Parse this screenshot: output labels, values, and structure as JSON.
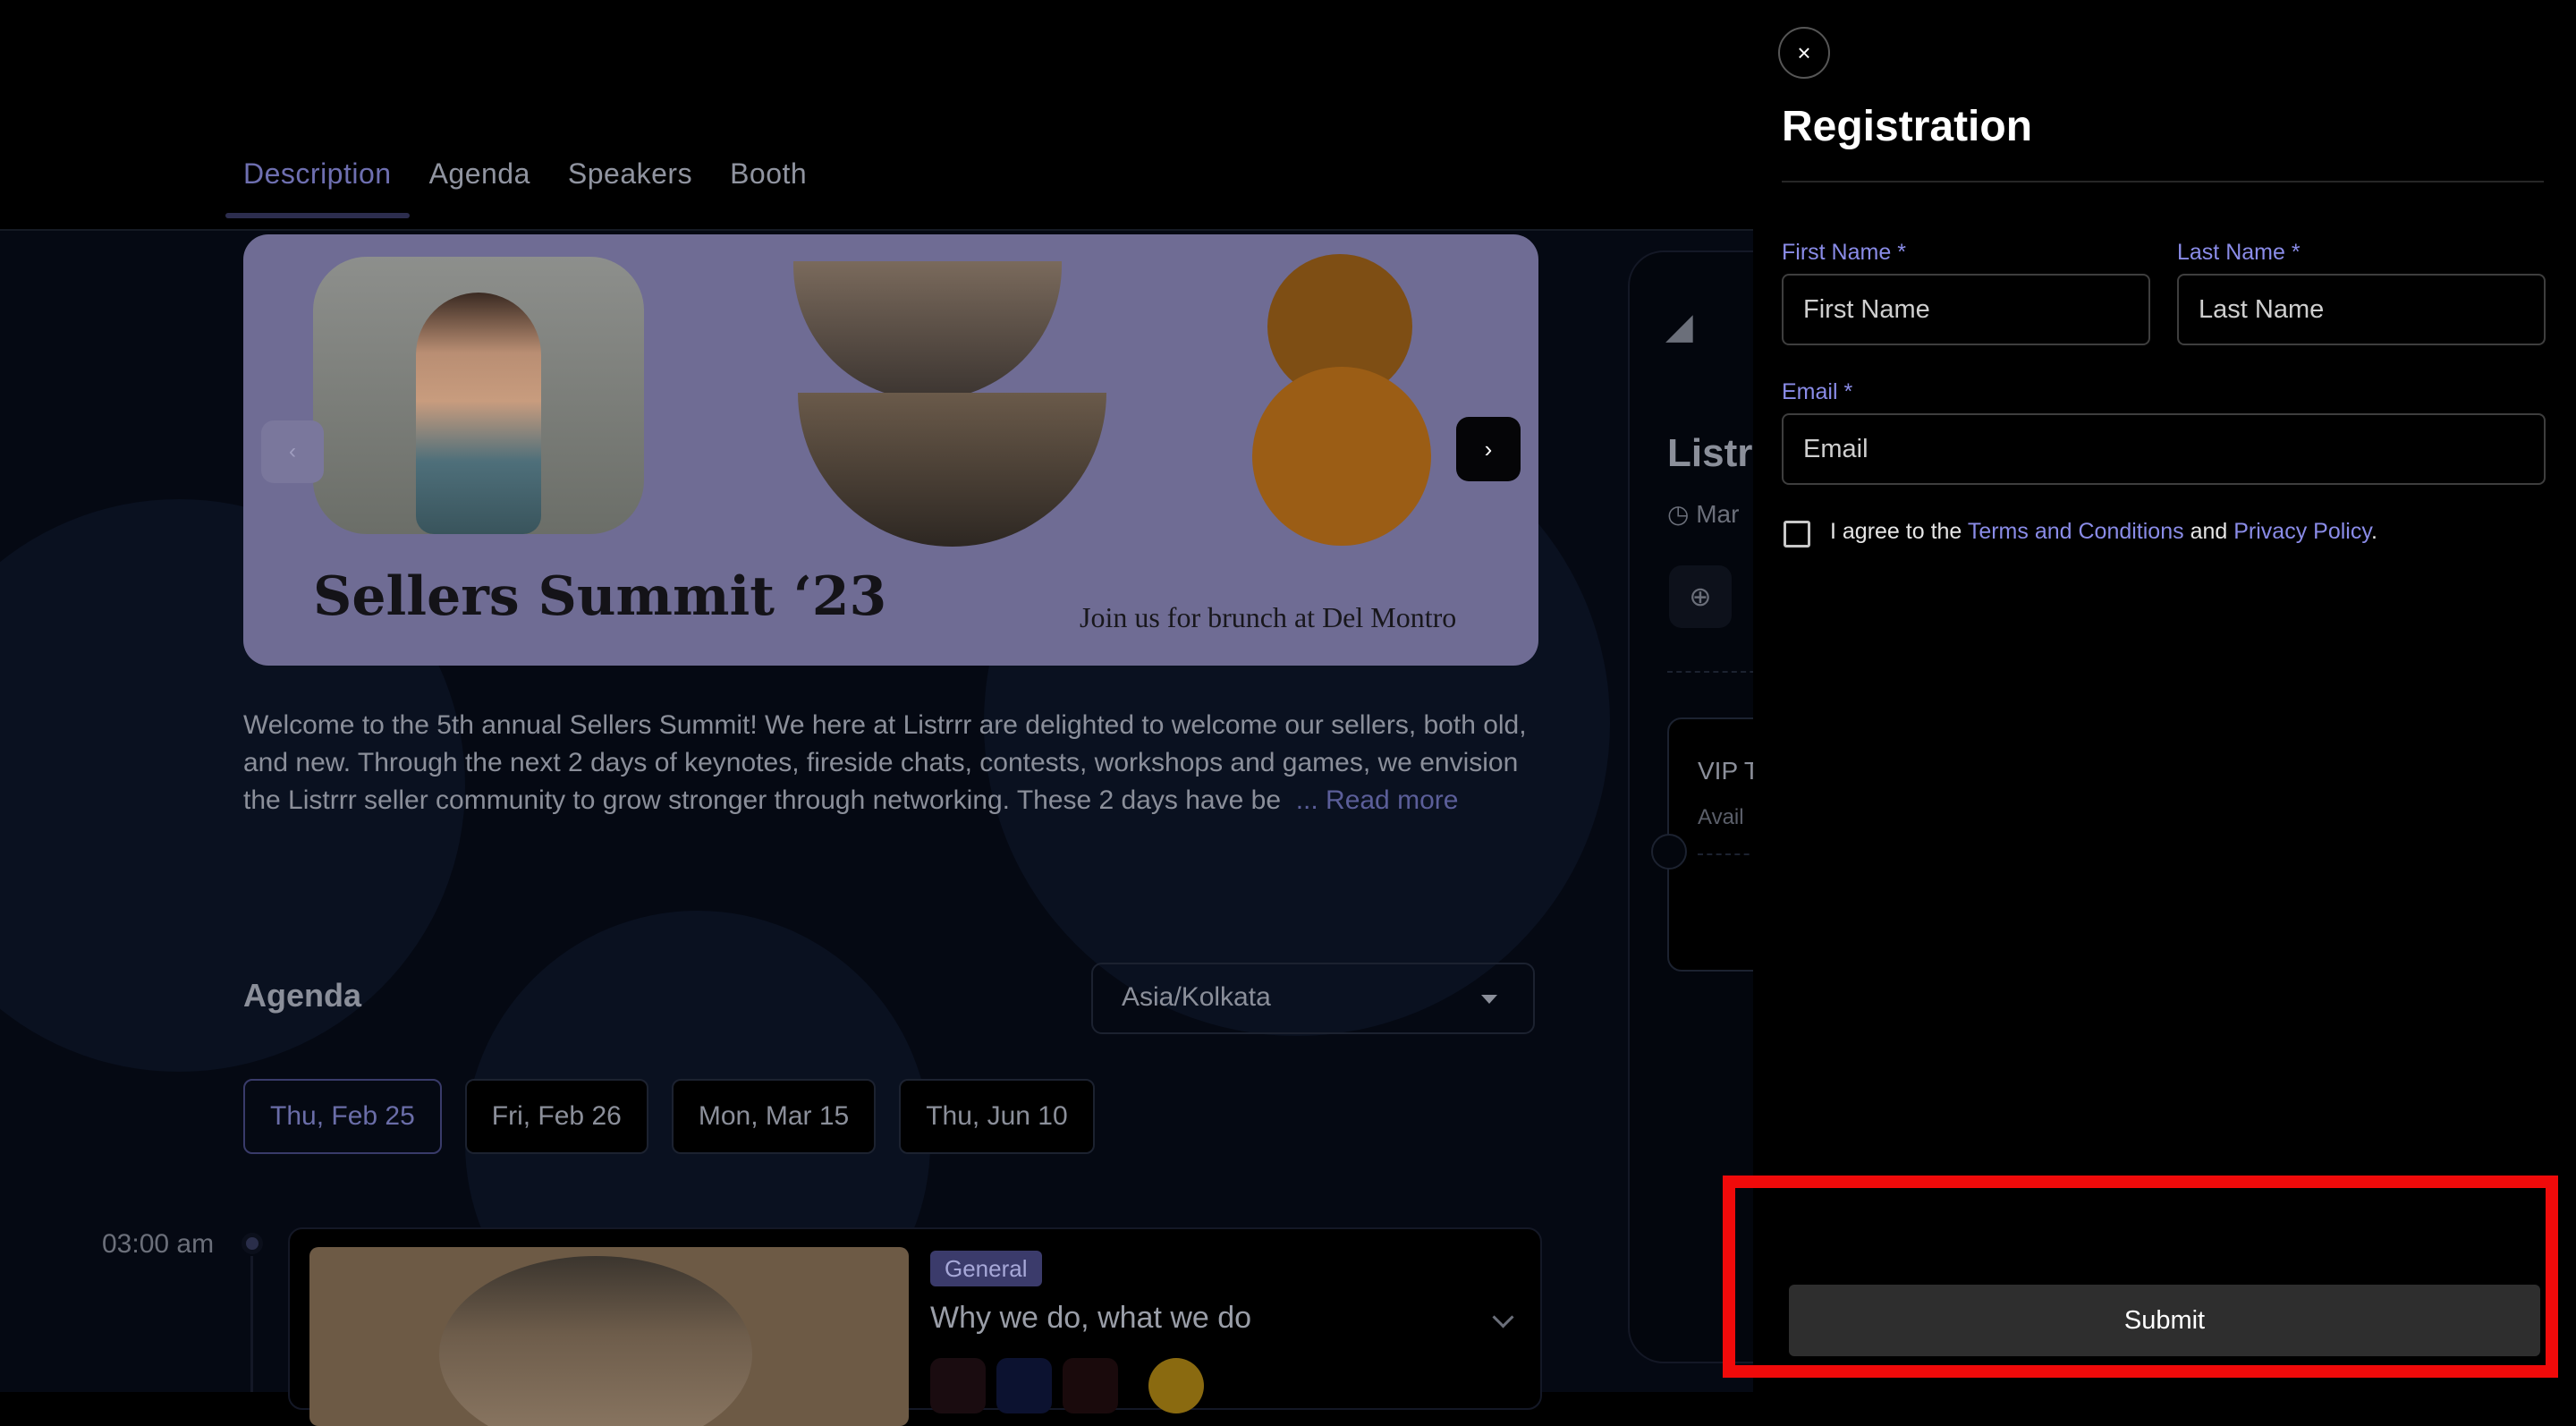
{
  "tabs": [
    {
      "label": "Description",
      "active": true
    },
    {
      "label": "Agenda"
    },
    {
      "label": "Speakers"
    },
    {
      "label": "Booth"
    }
  ],
  "banner": {
    "title": "Sellers Summit ‘23",
    "subtitle": "Join us for brunch at Del Montro",
    "prev_icon": "‹",
    "next_icon": "›"
  },
  "description": {
    "text": "Welcome to the 5th annual Sellers Summit! We here at Listrrr are delighted to welcome our sellers, both old, and new. Through the next 2 days of keynotes, fireside chats, contests, workshops and games, we envision the Listrrr seller community to grow stronger through networking. These 2 days have be",
    "read_more": "... Read more"
  },
  "agenda": {
    "heading": "Agenda",
    "timezone": "Asia/Kolkata",
    "dates": [
      "Thu, Feb 25",
      "Fri, Feb 26",
      "Mon, Mar 15",
      "Thu, Jun 10"
    ],
    "active_date_index": 0,
    "session": {
      "time": "03:00 am",
      "badge": "General",
      "title": "Why we do, what we do"
    }
  },
  "side_card": {
    "name_partial": "Listrr",
    "date_partial": "Mar",
    "ticket_name_partial": "VIP T",
    "ticket_avail_partial": "Avail"
  },
  "registration": {
    "close_icon": "×",
    "title": "Registration",
    "first_name_label": "First Name",
    "last_name_label": "Last Name",
    "email_label": "Email",
    "required_mark": "*",
    "first_name_placeholder": "First Name",
    "last_name_placeholder": "Last Name",
    "email_placeholder": "Email",
    "agree_prefix": "I agree to the",
    "terms_link": "Terms and Conditions",
    "agree_and": "and",
    "privacy_link": "Privacy Policy",
    "agree_suffix": ".",
    "submit_label": "Submit"
  },
  "colors": {
    "accent": "#8a8ce8",
    "highlight": "#f00a0a",
    "submit_bg": "#2e2e2e"
  }
}
